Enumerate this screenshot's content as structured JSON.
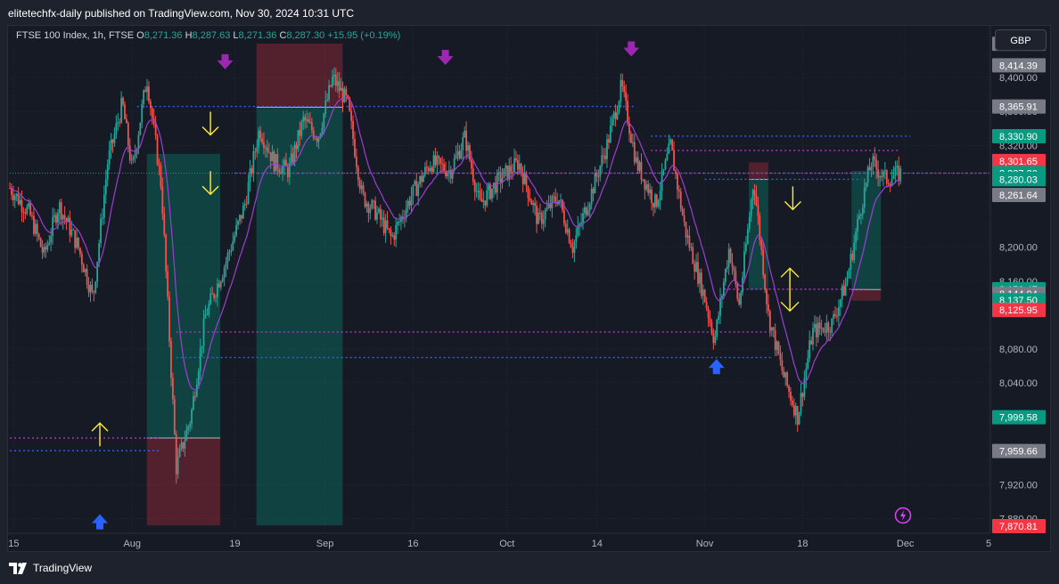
{
  "header": {
    "published": "elitetechfx-daily published on TradingView.com, Nov 30, 2024 10:31 UTC"
  },
  "legend": {
    "symbol": "FTSE 100 Index, 1h, FTSE",
    "o_label": "O",
    "o_value": "8,271.36",
    "h_label": "H",
    "h_value": "8,287.63",
    "l_label": "L",
    "l_value": "8,271.36",
    "c_label": "C",
    "c_value": "8,287.30",
    "change": "+15.95 (+0.19%)"
  },
  "currency": "GBP",
  "footer": {
    "brand": "TradingView"
  },
  "colors": {
    "up": "#26a69a",
    "down": "#ef5350",
    "bg": "#161a25",
    "panel": "#1e222d",
    "blue_line": "#2962ff",
    "magenta_line": "#e040fb",
    "yellow_arrow": "#ffeb3b",
    "purple_arrow": "#9c27b0",
    "blue_arrow": "#2962ff"
  },
  "chart_data": {
    "type": "candlestick",
    "symbol": "FTSE 100 Index",
    "interval": "1h",
    "y_axis": {
      "ticks": [
        "8,400.00",
        "8,360.00",
        "8,320.00",
        "8,200.00",
        "8,160.00",
        "8,080.00",
        "8,040.00",
        "7,920.00",
        "7,880.00"
      ],
      "tick_values": [
        8400,
        8360,
        8320,
        8200,
        8160,
        8080,
        8040,
        7920,
        7880
      ],
      "range": [
        7868,
        8440
      ]
    },
    "x_axis": {
      "ticks": [
        "15",
        "Aug",
        "19",
        "Sep",
        "16",
        "Oct",
        "14",
        "Nov",
        "18",
        "Dec",
        "5"
      ]
    },
    "price_labels": [
      {
        "text": "8,439.91",
        "value": 8439.91,
        "color": "#787b86"
      },
      {
        "text": "8,414.39",
        "value": 8414.39,
        "color": "#787b86"
      },
      {
        "text": "8,365.91",
        "value": 8365.91,
        "color": "#787b86"
      },
      {
        "text": "8,330.90",
        "value": 8330.9,
        "color": "#089981"
      },
      {
        "text": "8,301.65",
        "value": 8301.65,
        "color": "#f23645"
      },
      {
        "text": "8,287.30",
        "value": 8287.3,
        "color": "#089981"
      },
      {
        "text": "8,280.44",
        "value": 8280.44,
        "color": "#089981"
      },
      {
        "text": "8,280.03",
        "value": 8280.03,
        "color": "#089981"
      },
      {
        "text": "8,261.64",
        "value": 8261.64,
        "color": "#787b86"
      },
      {
        "text": "8,150.47",
        "value": 8150.47,
        "color": "#089981"
      },
      {
        "text": "8,144.94",
        "value": 8144.94,
        "color": "#787b86"
      },
      {
        "text": "8,137.50",
        "value": 8137.5,
        "color": "#089981"
      },
      {
        "text": "8,125.95",
        "value": 8125.95,
        "color": "#f23645"
      },
      {
        "text": "7,999.58",
        "value": 7999.58,
        "color": "#089981"
      },
      {
        "text": "7,959.66",
        "value": 7959.66,
        "color": "#787b86"
      },
      {
        "text": "7,870.81",
        "value": 7870.81,
        "color": "#f23645"
      }
    ],
    "price_path": [
      [
        0,
        8270
      ],
      [
        0.02,
        8240
      ],
      [
        0.035,
        8190
      ],
      [
        0.05,
        8250
      ],
      [
        0.07,
        8200
      ],
      [
        0.085,
        8140
      ],
      [
        0.1,
        8300
      ],
      [
        0.115,
        8370
      ],
      [
        0.125,
        8290
      ],
      [
        0.14,
        8400
      ],
      [
        0.155,
        8270
      ],
      [
        0.17,
        7940
      ],
      [
        0.185,
        8000
      ],
      [
        0.2,
        8120
      ],
      [
        0.22,
        8180
      ],
      [
        0.24,
        8250
      ],
      [
        0.255,
        8340
      ],
      [
        0.27,
        8300
      ],
      [
        0.285,
        8290
      ],
      [
        0.3,
        8350
      ],
      [
        0.315,
        8330
      ],
      [
        0.33,
        8400
      ],
      [
        0.345,
        8370
      ],
      [
        0.36,
        8260
      ],
      [
        0.375,
        8240
      ],
      [
        0.39,
        8210
      ],
      [
        0.41,
        8260
      ],
      [
        0.43,
        8300
      ],
      [
        0.45,
        8290
      ],
      [
        0.465,
        8330
      ],
      [
        0.48,
        8250
      ],
      [
        0.5,
        8280
      ],
      [
        0.52,
        8300
      ],
      [
        0.54,
        8230
      ],
      [
        0.56,
        8260
      ],
      [
        0.575,
        8200
      ],
      [
        0.59,
        8250
      ],
      [
        0.61,
        8320
      ],
      [
        0.625,
        8390
      ],
      [
        0.64,
        8300
      ],
      [
        0.66,
        8250
      ],
      [
        0.675,
        8320
      ],
      [
        0.69,
        8220
      ],
      [
        0.71,
        8140
      ],
      [
        0.72,
        8090
      ],
      [
        0.735,
        8200
      ],
      [
        0.745,
        8130
      ],
      [
        0.76,
        8280
      ],
      [
        0.775,
        8120
      ],
      [
        0.79,
        8050
      ],
      [
        0.805,
        8000
      ],
      [
        0.82,
        8100
      ],
      [
        0.84,
        8110
      ],
      [
        0.855,
        8160
      ],
      [
        0.87,
        8250
      ],
      [
        0.88,
        8300
      ],
      [
        0.895,
        8280
      ],
      [
        0.91,
        8287
      ]
    ],
    "horizontal_levels": [
      {
        "value": 8365.91,
        "from": 0.13,
        "to": 0.64,
        "color": "blue"
      },
      {
        "value": 8330.9,
        "from": 0.655,
        "to": 0.92,
        "color": "blue"
      },
      {
        "value": 8314,
        "from": 0.655,
        "to": 0.91,
        "color": "magenta"
      },
      {
        "value": 8287.3,
        "from": 0.23,
        "to": 1.0,
        "color": "magenta"
      },
      {
        "value": 8280.03,
        "from": 0.71,
        "to": 0.87,
        "color": "blue"
      },
      {
        "value": 8150.47,
        "from": 0.73,
        "to": 0.875,
        "color": "magenta"
      },
      {
        "value": 8100,
        "from": 0.17,
        "to": 0.78,
        "color": "magenta"
      },
      {
        "value": 8070,
        "from": 0.17,
        "to": 0.78,
        "color": "blue"
      },
      {
        "value": 7975,
        "from": 0.0,
        "to": 0.155,
        "color": "magenta"
      },
      {
        "value": 7960,
        "from": 0.0,
        "to": 0.155,
        "color": "blue"
      }
    ],
    "position_boxes": [
      {
        "x0": 0.14,
        "x1": 0.215,
        "entry": 7975,
        "target": 8310,
        "stop": 7872,
        "profit_on_top": true
      },
      {
        "x0": 0.252,
        "x1": 0.34,
        "entry": 8365,
        "target": 7872,
        "stop": 8440,
        "profit_on_top": false
      },
      {
        "x0": 0.755,
        "x1": 0.775,
        "entry": 8280,
        "target": 8150,
        "stop": 8300,
        "profit_on_top": false
      },
      {
        "x0": 0.86,
        "x1": 0.89,
        "entry": 8150,
        "target": 8290,
        "stop": 8137,
        "profit_on_top": true
      }
    ],
    "signals": [
      {
        "type": "purple-down",
        "x": 0.22,
        "value": 8415
      },
      {
        "type": "purple-down",
        "x": 0.445,
        "value": 8420
      },
      {
        "type": "purple-down",
        "x": 0.635,
        "value": 8430
      },
      {
        "type": "yellow-down",
        "x": 0.205,
        "value": 8345
      },
      {
        "type": "yellow-down",
        "x": 0.205,
        "value": 8275
      },
      {
        "type": "yellow-down",
        "x": 0.8,
        "value": 8257
      },
      {
        "type": "yellow-updown",
        "x": 0.797,
        "value": 8150
      },
      {
        "type": "yellow-up",
        "x": 0.092,
        "value": 7980
      },
      {
        "type": "blue-up",
        "x": 0.092,
        "value": 7880
      },
      {
        "type": "blue-up",
        "x": 0.722,
        "value": 8063
      }
    ]
  }
}
